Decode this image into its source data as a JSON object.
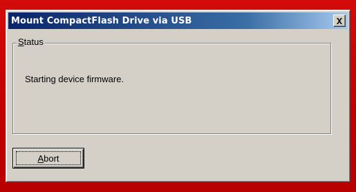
{
  "window": {
    "title": "Mount CompactFlash Drive via USB",
    "close_icon": "close-icon"
  },
  "status_group": {
    "label_mnemonic": "S",
    "label_rest": "tatus",
    "message": "Starting device firmware."
  },
  "abort_button": {
    "label_mnemonic": "A",
    "label_rest": "bort"
  },
  "colors": {
    "background": "#c80000",
    "window_face": "#d4d0c8",
    "titlebar_start": "#0a246a",
    "titlebar_end": "#a6caf0",
    "title_text": "#ffffff"
  }
}
